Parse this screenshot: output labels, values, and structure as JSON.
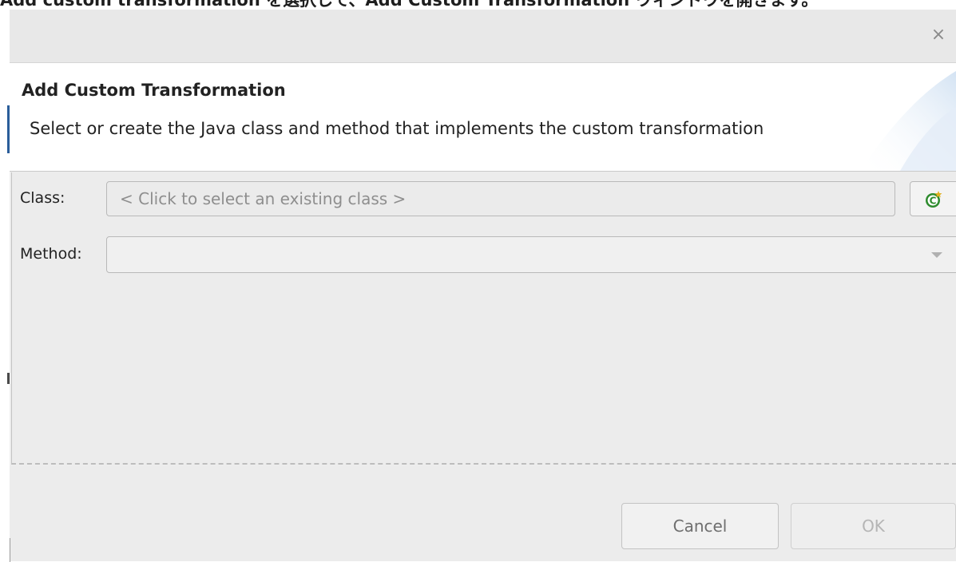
{
  "caption": {
    "text": "Add custom transformation を選択して、Add Custom Transformation ウィンドウを開きます。"
  },
  "dialog": {
    "close_glyph": "×",
    "banner": {
      "title": "Add Custom Transformation",
      "description": "Select or create the Java class and method that implements the custom transformation"
    },
    "form": {
      "class_label": "Class:",
      "class_placeholder": "< Click to select an existing class >",
      "new_class_icon": "new-java-class-icon",
      "method_label": "Method:",
      "method_value": ""
    },
    "buttons": {
      "cancel": "Cancel",
      "ok": "OK"
    }
  },
  "colors": {
    "dialog_bg": "#ededed",
    "banner_bg": "#ffffff",
    "icon_green": "#2e8b2e",
    "icon_badge": "#e0b020"
  }
}
